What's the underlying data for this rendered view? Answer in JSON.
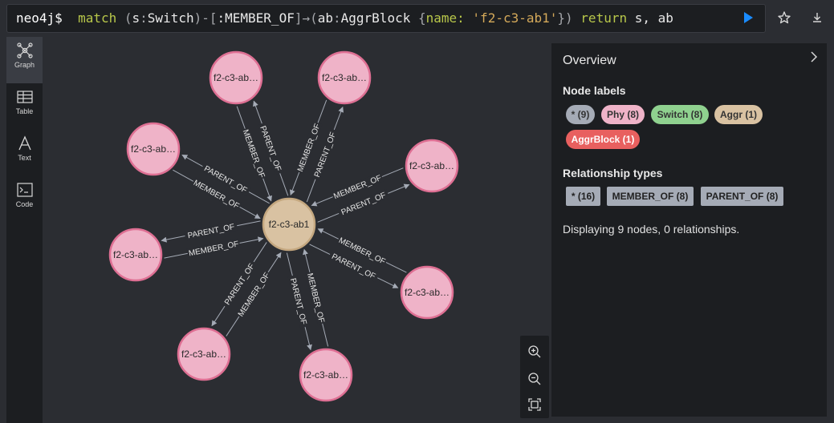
{
  "query": {
    "prompt": "neo4j$",
    "kw_match": "match",
    "p_open1": "(",
    "var_s": "s",
    "p_colon1": ":",
    "label_switch": "Switch",
    "p_rel_open": ")-[",
    "rel_type": ":MEMBER_OF",
    "p_rel_close": "]→(",
    "var_ab": "ab",
    "p_colon2": ":",
    "label_aggr": "AggrBlock",
    "p_brace_open": " {",
    "prop_key": "name:",
    "prop_val": "'f2-c3-ab1'",
    "p_brace_close": "})",
    "kw_return": "return",
    "return_vars": "s, ab"
  },
  "toolbar_icons": [
    "play-icon",
    "star-icon",
    "download-icon"
  ],
  "rail": {
    "items": [
      {
        "label": "Graph",
        "icon": "graph-icon",
        "active": true
      },
      {
        "label": "Table",
        "icon": "table-icon",
        "active": false
      },
      {
        "label": "Text",
        "icon": "text-icon",
        "active": false
      },
      {
        "label": "Code",
        "icon": "code-icon",
        "active": false
      }
    ]
  },
  "graph": {
    "center": {
      "label": "f2-c3-ab1",
      "color": "#d9c2a2",
      "border": "#c4a77f"
    },
    "outer_label": "f2-c3-ab…",
    "outer_color": "#efb3c8",
    "outer_border": "#de6f93",
    "edge_color": "#a5abb6",
    "edge_labels": {
      "member": "MEMBER_OF",
      "parent": "PARENT_OF"
    }
  },
  "zoom": {
    "icons": [
      "zoom-in-icon",
      "zoom-out-icon",
      "fit-icon"
    ]
  },
  "overview": {
    "title": "Overview",
    "node_labels_title": "Node labels",
    "node_labels": [
      {
        "text": "* (9)",
        "color": "#a5abb6"
      },
      {
        "text": "Phy (8)",
        "color": "#efb3c8"
      },
      {
        "text": "Switch (8)",
        "color": "#8fd18f"
      },
      {
        "text": "Aggr (1)",
        "color": "#d9c2a2"
      },
      {
        "text": "AggrBlock (1)",
        "color": "#e8605f"
      }
    ],
    "rel_types_title": "Relationship types",
    "rel_types": [
      {
        "text": "* (16)"
      },
      {
        "text": "MEMBER_OF (8)"
      },
      {
        "text": "PARENT_OF (8)"
      }
    ],
    "summary": "Displaying 9 nodes, 0 relationships."
  }
}
